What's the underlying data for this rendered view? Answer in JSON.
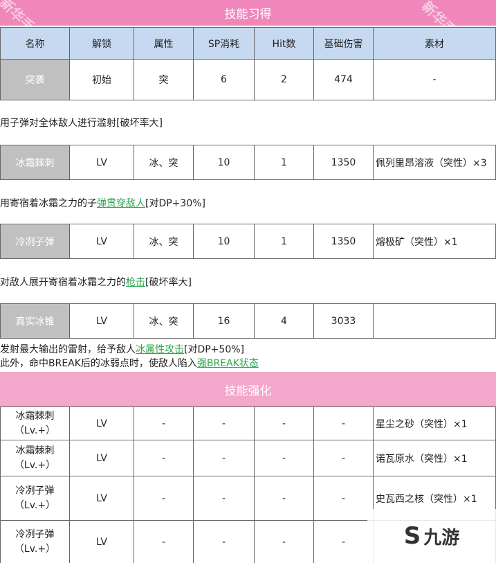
{
  "section1": {
    "title": "技能习得"
  },
  "watermark": "新华手游网",
  "columns": [
    "名称",
    "解锁",
    "属性",
    "SP消耗",
    "Hit数",
    "基础伤害",
    "素材"
  ],
  "skills": [
    {
      "name": "突袭",
      "unlock": "初始",
      "attr": "突",
      "sp": "6",
      "hit": "2",
      "damage": "474",
      "material": "-"
    },
    {
      "name": "冰霜棘刺",
      "unlock": "LV",
      "attr": "冰、突",
      "sp": "10",
      "hit": "1",
      "damage": "1350",
      "material": "佩列里昂溶液（突性）×3"
    },
    {
      "name": "冷冽子弹",
      "unlock": "LV",
      "attr": "冰、突",
      "sp": "10",
      "hit": "1",
      "damage": "1350",
      "material": "熔极矿（突性）×1"
    },
    {
      "name": "真实冰锥",
      "unlock": "LV",
      "attr": "冰、突",
      "sp": "16",
      "hit": "4",
      "damage": "3033",
      "material": ""
    }
  ],
  "descriptions": {
    "d1": {
      "text": "用子弹对全体敌人进行滥射[破坏率大]"
    },
    "d2": {
      "pre": "用寄宿着冰霜之力的子",
      "link": "弹贯穿敌人",
      "post": "[对DP+30%]"
    },
    "d3": {
      "pre": "对敌人展开寄宿着冰霜之力的",
      "link": "枪击",
      "post": "[破坏率大]"
    },
    "d4a": {
      "pre": "发射最大输出的雷射，给予敌人",
      "link": "冰属性攻击",
      "post": "[对DP+50%]"
    },
    "d4b": {
      "pre": "此外，命中BREAK后的冰弱点时，使敌人陷入",
      "link": "强BREAK状态",
      "post": ""
    }
  },
  "section2": {
    "title": "技能强化"
  },
  "enhancements": [
    {
      "name1": "冰霜棘刺",
      "name2": "（Lv.+）",
      "unlock": "LV",
      "attr": "-",
      "sp": "-",
      "hit": "-",
      "damage": "-",
      "material": "星尘之砂（突性）×1"
    },
    {
      "name1": "冰霜棘刺",
      "name2": "（Lv.+）",
      "unlock": "LV",
      "attr": "-",
      "sp": "-",
      "hit": "-",
      "damage": "-",
      "material": "诺瓦原水（突性）×1"
    },
    {
      "name1": "冷冽子弹",
      "name2": "（Lv.+）",
      "unlock": "LV",
      "attr": "-",
      "sp": "-",
      "hit": "-",
      "damage": "-",
      "material": "史瓦西之核（突性）×1"
    },
    {
      "name1": "冷冽子弹",
      "name2": "（Lv.+）",
      "unlock": "LV",
      "attr": "-",
      "sp": "-",
      "hit": "-",
      "damage": "-",
      "material": ""
    }
  ],
  "logo": {
    "text": "九游",
    "mark": "S"
  }
}
